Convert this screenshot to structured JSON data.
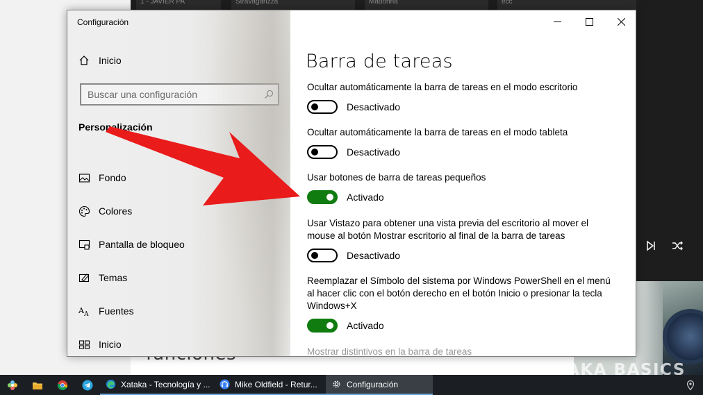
{
  "background": {
    "strip_texts": [
      "1 - JAVIER PA",
      "Stravaganzza",
      "Madonna",
      "ecc"
    ],
    "headline": "funciones",
    "watermark": "XATAKA BASICS"
  },
  "window": {
    "title": "Configuración",
    "caption": {
      "minimize": "minimize-icon",
      "maximize": "maximize-icon",
      "close": "close-icon"
    }
  },
  "sidebar": {
    "home_label": "Inicio",
    "search_placeholder": "Buscar una configuración",
    "section": "Personalización",
    "items": [
      {
        "label": "Fondo",
        "icon": "image-icon"
      },
      {
        "label": "Colores",
        "icon": "palette-icon"
      },
      {
        "label": "Pantalla de bloqueo",
        "icon": "lock-screen-icon"
      },
      {
        "label": "Temas",
        "icon": "themes-icon"
      },
      {
        "label": "Fuentes",
        "icon": "fonts-icon"
      },
      {
        "label": "Inicio",
        "icon": "start-icon"
      }
    ]
  },
  "content": {
    "title": "Barra de tareas",
    "settings": [
      {
        "label": "Ocultar automáticamente la barra de tareas en el modo escritorio",
        "state": "Desactivado",
        "on": false
      },
      {
        "label": "Ocultar automáticamente la barra de tareas en el modo tableta",
        "state": "Desactivado",
        "on": false
      },
      {
        "label": "Usar botones de barra de tareas pequeños",
        "state": "Activado",
        "on": true
      },
      {
        "label": "Usar Vistazo para obtener una vista previa del escritorio al mover el mouse al botón Mostrar escritorio al final de la barra de tareas",
        "state": "Desactivado",
        "on": false
      },
      {
        "label": "Reemplazar el Símbolo del sistema por Windows PowerShell en el menú al hacer clic con el botón derecho en el botón Inicio o presionar la tecla Windows+X",
        "state": "Activado",
        "on": true
      }
    ],
    "next_setting": "Mostrar distintivos en la barra de tareas"
  },
  "taskbar": {
    "apps": [
      {
        "label": "Xataka - Tecnología y ...",
        "icon": "edge-icon"
      },
      {
        "label": "Mike Oldfield - Retur...",
        "icon": "headphones-icon"
      },
      {
        "label": "Configuración",
        "icon": "settings-gear-icon"
      }
    ]
  },
  "colors": {
    "accent_on": "#107c10",
    "arrow": "#e81a1a",
    "taskbar": "#1b1f24"
  }
}
